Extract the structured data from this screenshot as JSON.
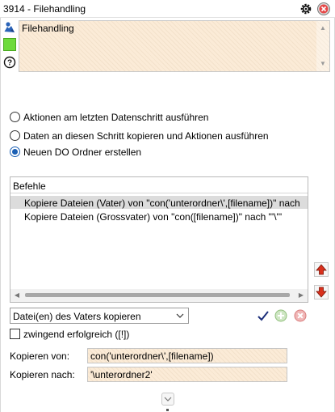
{
  "window": {
    "title": "3914 - Filehandling",
    "icons": [
      "settings-gear-icon",
      "close-icon"
    ]
  },
  "editor": {
    "text": "Filehandling",
    "icons": [
      "user-pin-icon",
      "color-swatch-icon",
      "help-icon"
    ],
    "swatch_color": "#6dda3c"
  },
  "options": [
    {
      "label": "Aktionen am letzten Datenschritt ausführen",
      "selected": false
    },
    {
      "label": "Daten an diesen Schritt kopieren und Aktionen ausführen",
      "selected": false
    },
    {
      "label": "Neuen DO Ordner erstellen",
      "selected": true
    }
  ],
  "commands": {
    "header": "Befehle",
    "items": [
      {
        "text": "Kopiere Dateien (Vater) von \"con('unterordner\\',[filename])\" nach",
        "selected": true
      },
      {
        "text": "Kopiere Dateien (Grossvater) von \"con([filename])\" nach \"'\\'\"",
        "selected": false
      }
    ]
  },
  "action": {
    "selected": "Datei(en) des Vaters kopieren",
    "buttons": [
      "confirm-check-icon",
      "add-icon",
      "remove-icon"
    ]
  },
  "checkbox": {
    "label": "zwingend erfolgreich ([!])",
    "checked": false
  },
  "fields": {
    "von_label": "Kopieren von:",
    "von_value": "con('unterordner\\',[filename])",
    "nach_label": "Kopieren nach:",
    "nach_value": "'\\unterordner2'"
  },
  "colors": {
    "accent": "#1a5fb4",
    "field_bg": "#fbebd7",
    "up_arrow": "#d9301c",
    "down_arrow": "#d9301c"
  }
}
